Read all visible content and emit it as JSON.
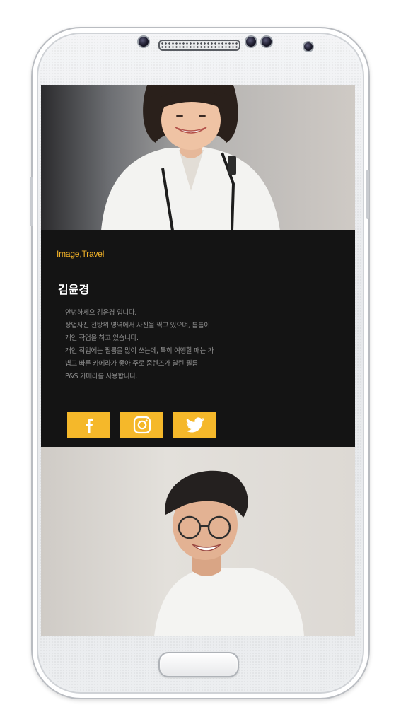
{
  "profile": {
    "category": "Image,Travel",
    "name": "김윤경",
    "bio_lines": [
      "안녕하세요 김윤경 입니다.",
      "상업사진 전방위 영역에서 사진을 찍고 있으며, 틈틈이",
      "개인 작업을 하고 있습니다.",
      "개인 작업에는 필름을 많이 쓰는데, 특히 여행할 때는 가",
      "볍고 빠른 카메라가 좋아 주로 줌렌즈가 달린 필름",
      "P&S 카메라를 사용합니다."
    ]
  },
  "social": [
    {
      "icon": "facebook-icon"
    },
    {
      "icon": "instagram-icon"
    },
    {
      "icon": "twitter-icon"
    }
  ],
  "colors": {
    "accent": "#f5b82a",
    "tag": "#f2b228",
    "card_bg": "#141414",
    "bio_text": "#8f8f8f"
  }
}
